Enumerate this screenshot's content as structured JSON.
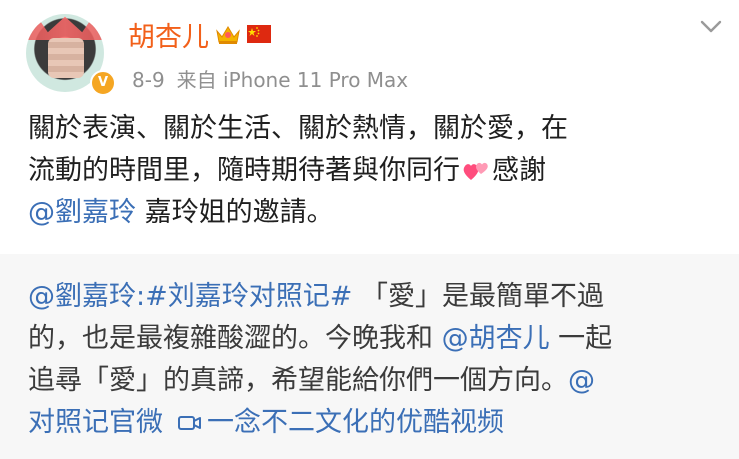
{
  "user": {
    "name": "胡杏儿",
    "badge_icon": "crown-icon",
    "flag_icon": "china-flag-icon",
    "verified_icon": "verified-v-icon",
    "name_color": "#f2601a"
  },
  "meta": {
    "date": "8-9",
    "source": "来自 iPhone 11 Pro Max"
  },
  "post": {
    "line1": "關於表演、關於生活、關於熱情，關於愛，在",
    "line2": "流動的時間里，隨時期待著與你同行",
    "line2_after": "感謝",
    "hearts_icon": "two-hearts-emoji",
    "mention": "@劉嘉玲",
    "line3_after": " 嘉玲姐的邀請。"
  },
  "repost": {
    "mention1": "@劉嘉玲",
    "colon": ":",
    "hashtag": "#刘嘉玲对照记#",
    "line1_rest": " 「愛」是最簡單不過",
    "line2_text": "的，也是最複雜酸澀的。今晚我和 ",
    "mention2": "@胡杏儿",
    "line2_rest": " 一起",
    "line3_text": "追尋「愛」的真諦，希望能給你們一個方向。",
    "line3_at": "@",
    "mention3": "对照记官微",
    "video_icon": "video-link-icon",
    "video_link": "一念不二文化的优酷视频",
    "link_color": "#3b6fb6"
  },
  "more_icon": "chevron-down-icon"
}
